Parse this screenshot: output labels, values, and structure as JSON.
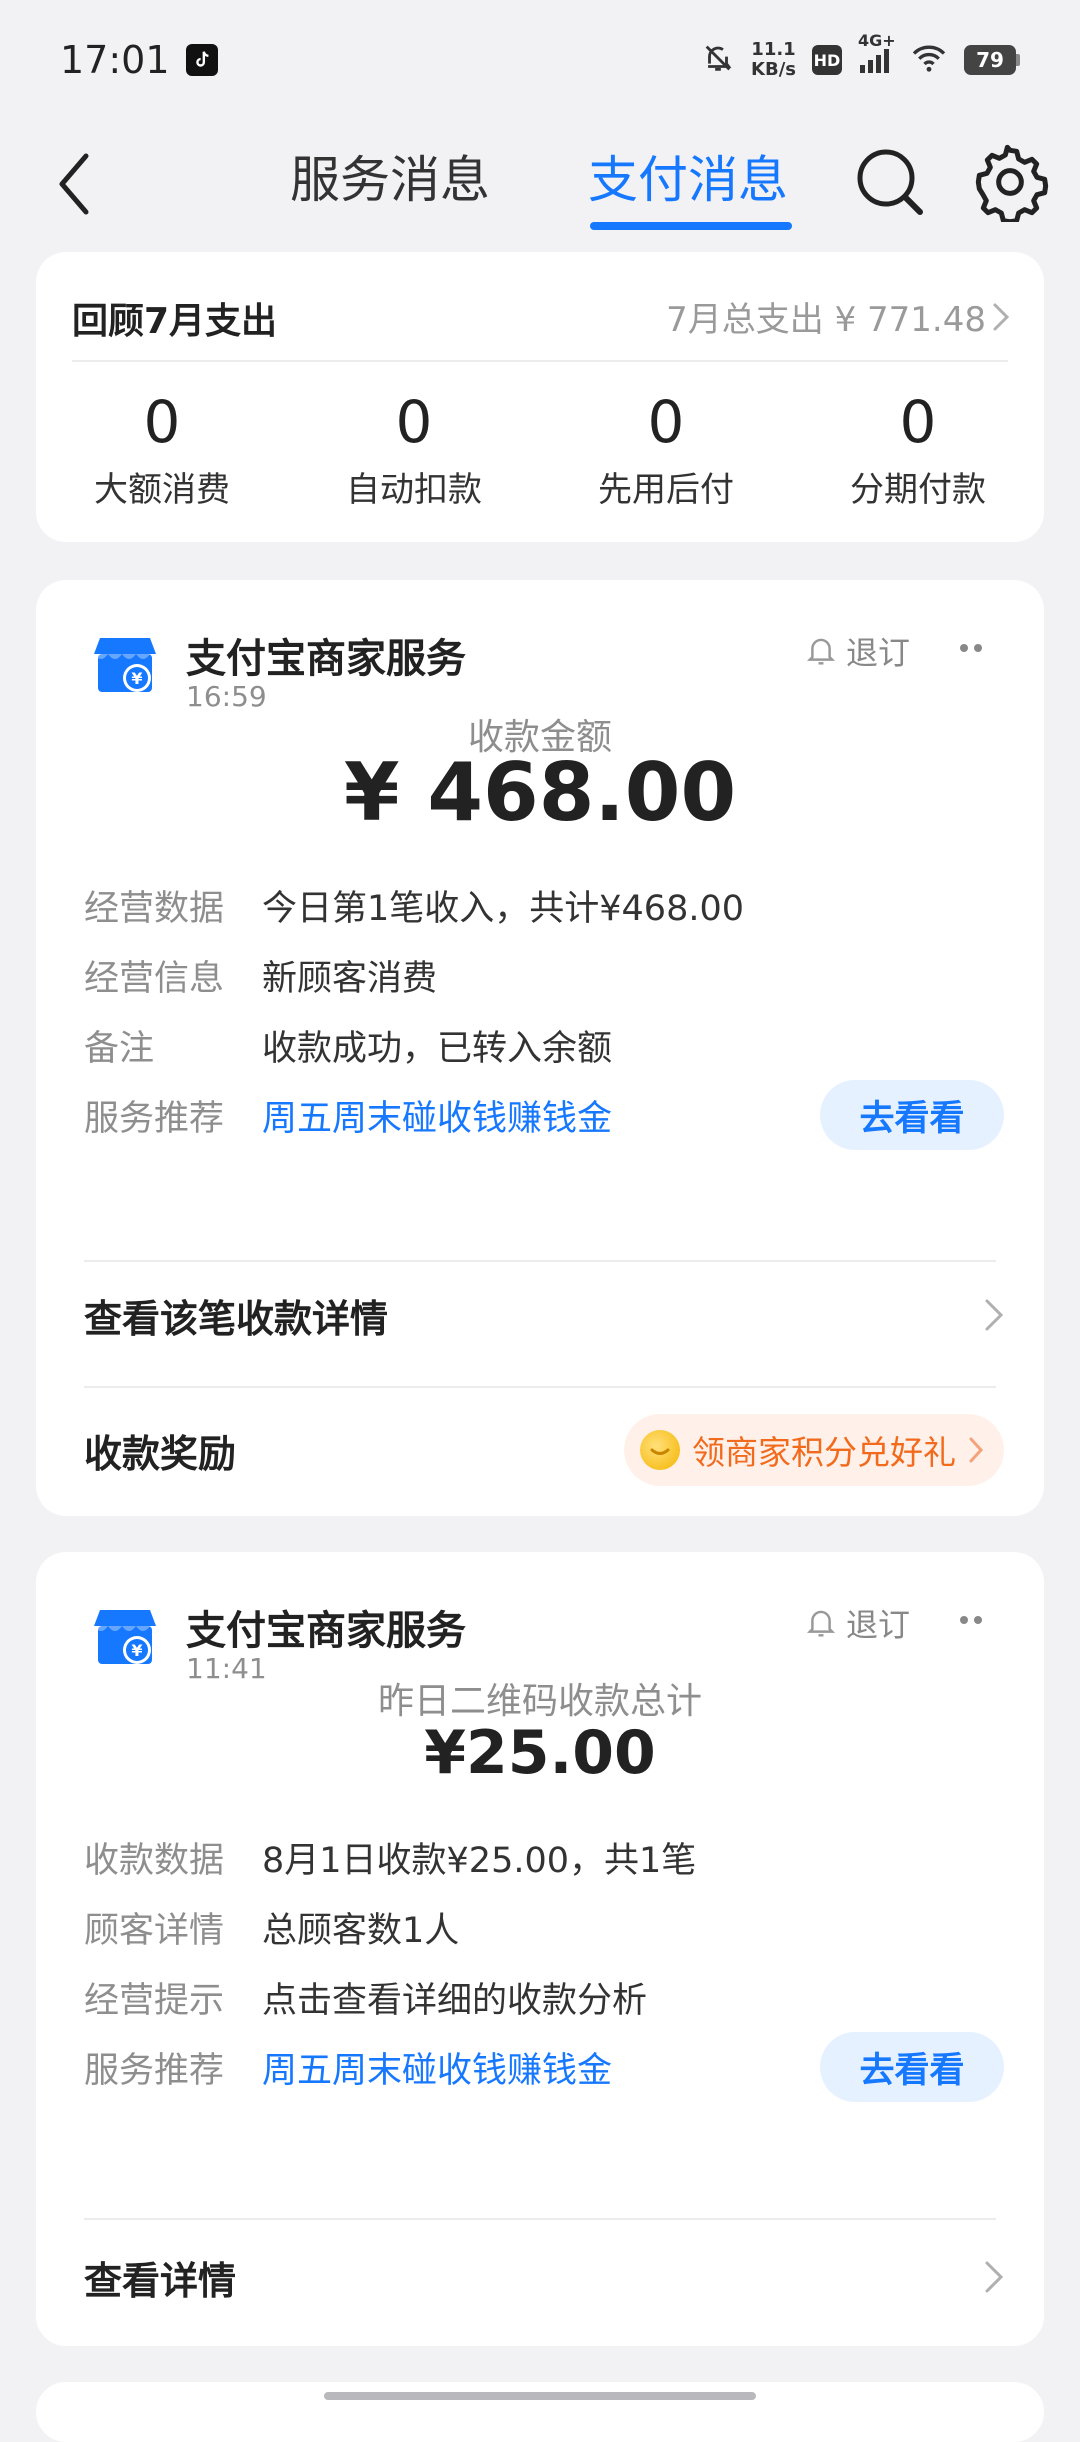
{
  "status_bar": {
    "time": "17:01",
    "net_speed_value": "11.1",
    "net_speed_unit": "KB/s",
    "hd": "HD",
    "network": "4G+",
    "battery": "79"
  },
  "nav": {
    "tabs": [
      {
        "label": "服务消息",
        "active": false
      },
      {
        "label": "支付消息",
        "active": true
      }
    ],
    "icons": [
      "back-icon",
      "search-icon",
      "gear-icon"
    ]
  },
  "summary": {
    "title": "回顾7月支出",
    "total_text": "7月总支出 ¥ 771.48",
    "stats": [
      {
        "value": "0",
        "label": "大额消费"
      },
      {
        "value": "0",
        "label": "自动扣款"
      },
      {
        "value": "0",
        "label": "先用后付"
      },
      {
        "value": "0",
        "label": "分期付款"
      }
    ]
  },
  "messages": [
    {
      "merchant": "支付宝商家服务",
      "time": "16:59",
      "unsubscribe": "退订",
      "amount_label": "收款金额",
      "amount": "¥ 468.00",
      "rows": [
        {
          "key": "经营数据",
          "value": "今日第1笔收入，共计¥468.00"
        },
        {
          "key": "经营信息",
          "value": "新顾客消费"
        },
        {
          "key": "备注",
          "value": "收款成功，已转入余额"
        },
        {
          "key": "服务推荐",
          "value": "周五周末碰收钱赚钱金"
        }
      ],
      "go_button": "去看看",
      "detail_action": "查看该笔收款详情",
      "reward_label": "收款奖励",
      "reward_pill": "领商家积分兑好礼"
    },
    {
      "merchant": "支付宝商家服务",
      "time": "11:41",
      "unsubscribe": "退订",
      "amount_label": "昨日二维码收款总计",
      "amount": "¥25.00",
      "rows": [
        {
          "key": "收款数据",
          "value": "8月1日收款¥25.00，共1笔"
        },
        {
          "key": "顾客详情",
          "value": "总顾客数1人"
        },
        {
          "key": "经营提示",
          "value": "点击查看详细的收款分析"
        },
        {
          "key": "服务推荐",
          "value": "周五周末碰收钱赚钱金"
        }
      ],
      "go_button": "去看看",
      "detail_action": "查看详情"
    }
  ],
  "colors": {
    "accent": "#1677ff",
    "reward": "#f26b1d",
    "background": "#f2f2f4"
  }
}
